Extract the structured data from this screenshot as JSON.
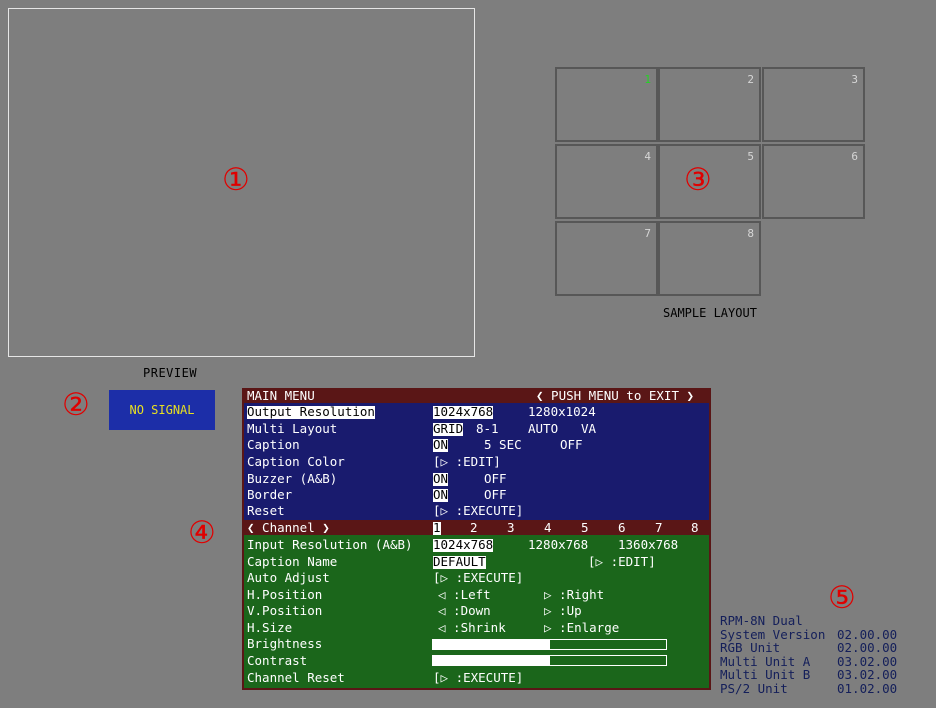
{
  "callouts": {
    "c1": "①",
    "c2": "②",
    "c3": "③",
    "c4": "④",
    "c5": "⑤"
  },
  "preview": {
    "label": "PREVIEW",
    "status": "NO SIGNAL"
  },
  "sample_layout": {
    "label": "SAMPLE LAYOUT",
    "cells": [
      "1",
      "2",
      "3",
      "4",
      "5",
      "6",
      "7",
      "8"
    ],
    "active_cell": "1"
  },
  "menu": {
    "title": "MAIN MENU",
    "exit_hint": "❮ PUSH MENU to EXIT ❯",
    "rows": {
      "output_resolution": {
        "label": "Output Resolution",
        "opt1": "1024x768",
        "opt2": "1280x1024"
      },
      "multi_layout": {
        "label": "Multi Layout",
        "opt1": "GRID",
        "opt2": "8-1",
        "opt3": "AUTO",
        "opt4": "VA"
      },
      "caption": {
        "label": "Caption",
        "opt1": "ON",
        "opt2": "5 SEC",
        "opt3": "OFF"
      },
      "caption_color": {
        "label": "Caption Color",
        "value": "[▷ :EDIT]"
      },
      "buzzer": {
        "label": "Buzzer (A&B)",
        "opt1": "ON",
        "opt2": "OFF"
      },
      "border": {
        "label": "Border",
        "opt1": "ON",
        "opt2": "OFF"
      },
      "reset": {
        "label": "Reset",
        "value": "[▷ :EXECUTE]"
      }
    },
    "channel": {
      "label": "❮ Channel ❯",
      "numbers": [
        "1",
        "2",
        "3",
        "4",
        "5",
        "6",
        "7",
        "8"
      ]
    },
    "channel_rows": {
      "input_resolution": {
        "label": "Input Resolution (A&B)",
        "opt1": "1024x768",
        "opt2": "1280x768",
        "opt3": "1360x768"
      },
      "caption_name": {
        "label": "Caption Name",
        "opt1": "DEFAULT",
        "opt2": "[▷ :EDIT]"
      },
      "auto_adjust": {
        "label": "Auto Adjust",
        "value": "[▷ :EXECUTE]"
      },
      "h_position": {
        "label": "H.Position",
        "opt1": "◁ :Left",
        "opt2": "▷ :Right"
      },
      "v_position": {
        "label": "V.Position",
        "opt1": "◁ :Down",
        "opt2": "▷ :Up"
      },
      "h_size": {
        "label": "H.Size",
        "opt1": "◁ :Shrink",
        "opt2": "▷ :Enlarge"
      },
      "brightness": {
        "label": "Brightness",
        "level": 0.5
      },
      "contrast": {
        "label": "Contrast",
        "level": 0.5
      },
      "channel_reset": {
        "label": "Channel Reset",
        "value": "[▷ :EXECUTE]"
      }
    }
  },
  "system_info": {
    "model": "RPM-8N Dual",
    "rows": [
      {
        "label": "System Version",
        "value": "02.00.00"
      },
      {
        "label": "RGB Unit",
        "value": "02.00.00"
      },
      {
        "label": "Multi Unit A",
        "value": "03.02.00"
      },
      {
        "label": "Multi Unit B",
        "value": "03.02.00"
      },
      {
        "label": "PS/2 Unit",
        "value": "01.02.00"
      }
    ]
  },
  "colors": {
    "callout": "#e00000",
    "menu_header": "#5a1616",
    "menu_blue": "#191b6e",
    "menu_green": "#1b661b",
    "preview_bg": "#1c2ea8"
  }
}
